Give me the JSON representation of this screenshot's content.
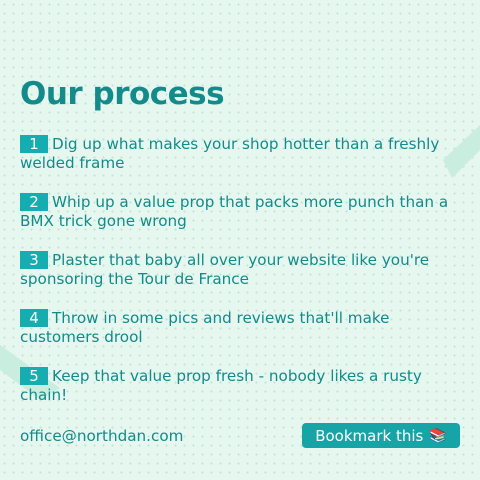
{
  "title": "Our process",
  "steps": [
    {
      "number": "1",
      "text": "Dig up what makes your shop hotter than a freshly welded frame"
    },
    {
      "number": "2",
      "text": "Whip up a value prop that packs more punch than a BMX trick gone wrong"
    },
    {
      "number": "3",
      "text": "Plaster that baby all over your website like you're sponsoring the Tour de France"
    },
    {
      "number": "4",
      "text": "Throw in some pics and reviews that'll make customers drool"
    },
    {
      "number": "5",
      "text": "Keep that value prop fresh - nobody likes a rusty chain!"
    }
  ],
  "footer": {
    "email": "office@northdan.com",
    "bookmark_label": "Bookmark this",
    "bookmark_icon": "📚"
  },
  "colors": {
    "background": "#e6f7ef",
    "accent": "#16adb1",
    "text": "#128b8a"
  }
}
